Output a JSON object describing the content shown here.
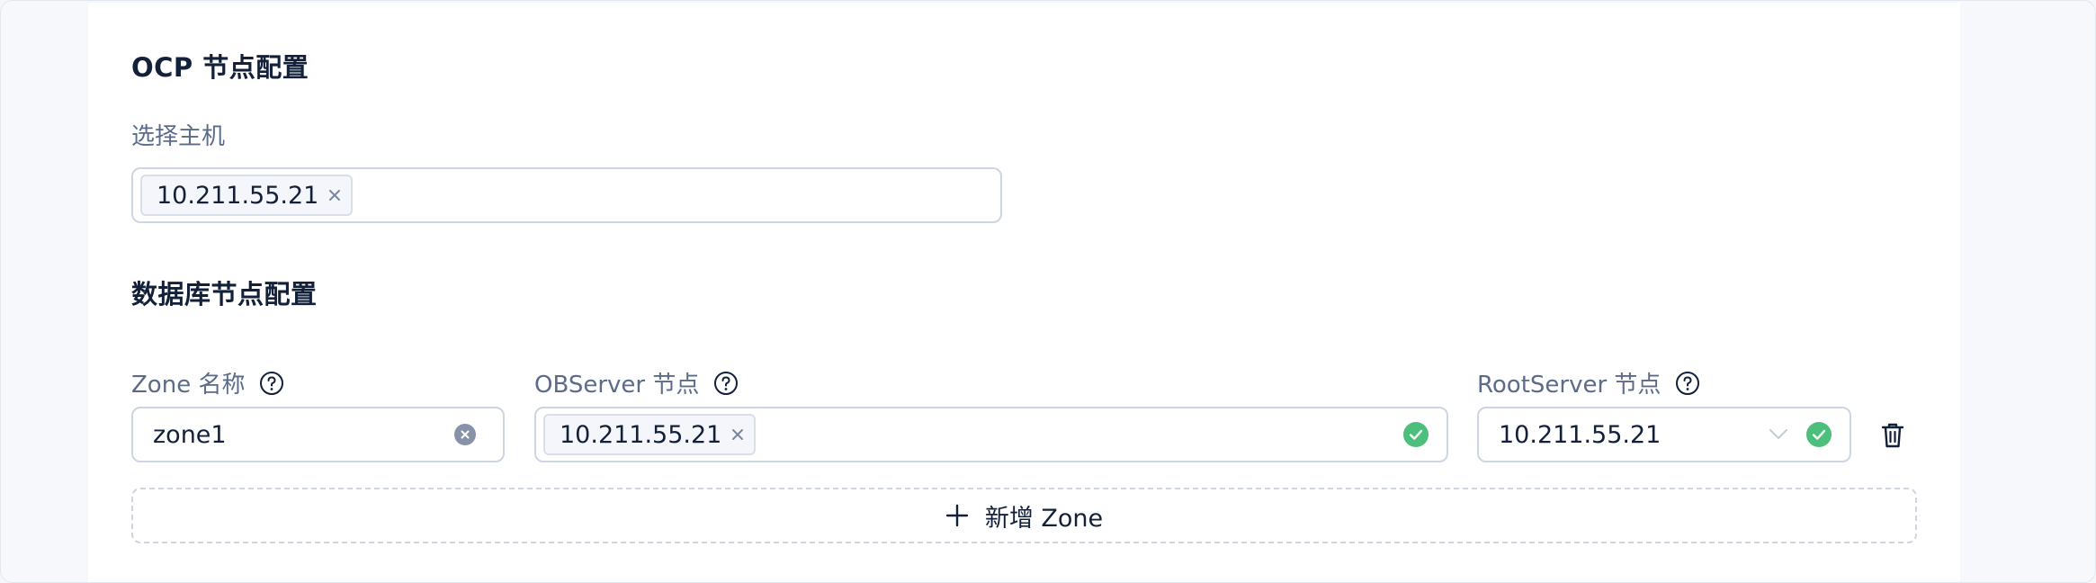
{
  "ocp": {
    "title": "OCP 节点配置",
    "select_host_label": "选择主机",
    "selected_hosts": [
      "10.211.55.21"
    ]
  },
  "db": {
    "title": "数据库节点配置",
    "zone_name_label": "Zone 名称",
    "observer_label": "OBServer 节点",
    "rootserver_label": "RootServer 节点",
    "rows": [
      {
        "zone_name": "zone1",
        "observer_tags": [
          "10.211.55.21"
        ],
        "rootserver": "10.211.55.21"
      }
    ],
    "add_zone_label": "新增 Zone"
  },
  "colors": {
    "success": "#4cbf7d",
    "border": "#cdd5e4",
    "label": "#5c6b8a",
    "text": "#132039"
  },
  "icons": {
    "help": "question-circle-icon",
    "tag_close": "close-icon",
    "clear": "clear-circle-icon",
    "valid": "check-circle-icon",
    "dropdown": "chevron-down-icon",
    "delete": "trash-icon",
    "add": "plus-icon"
  }
}
